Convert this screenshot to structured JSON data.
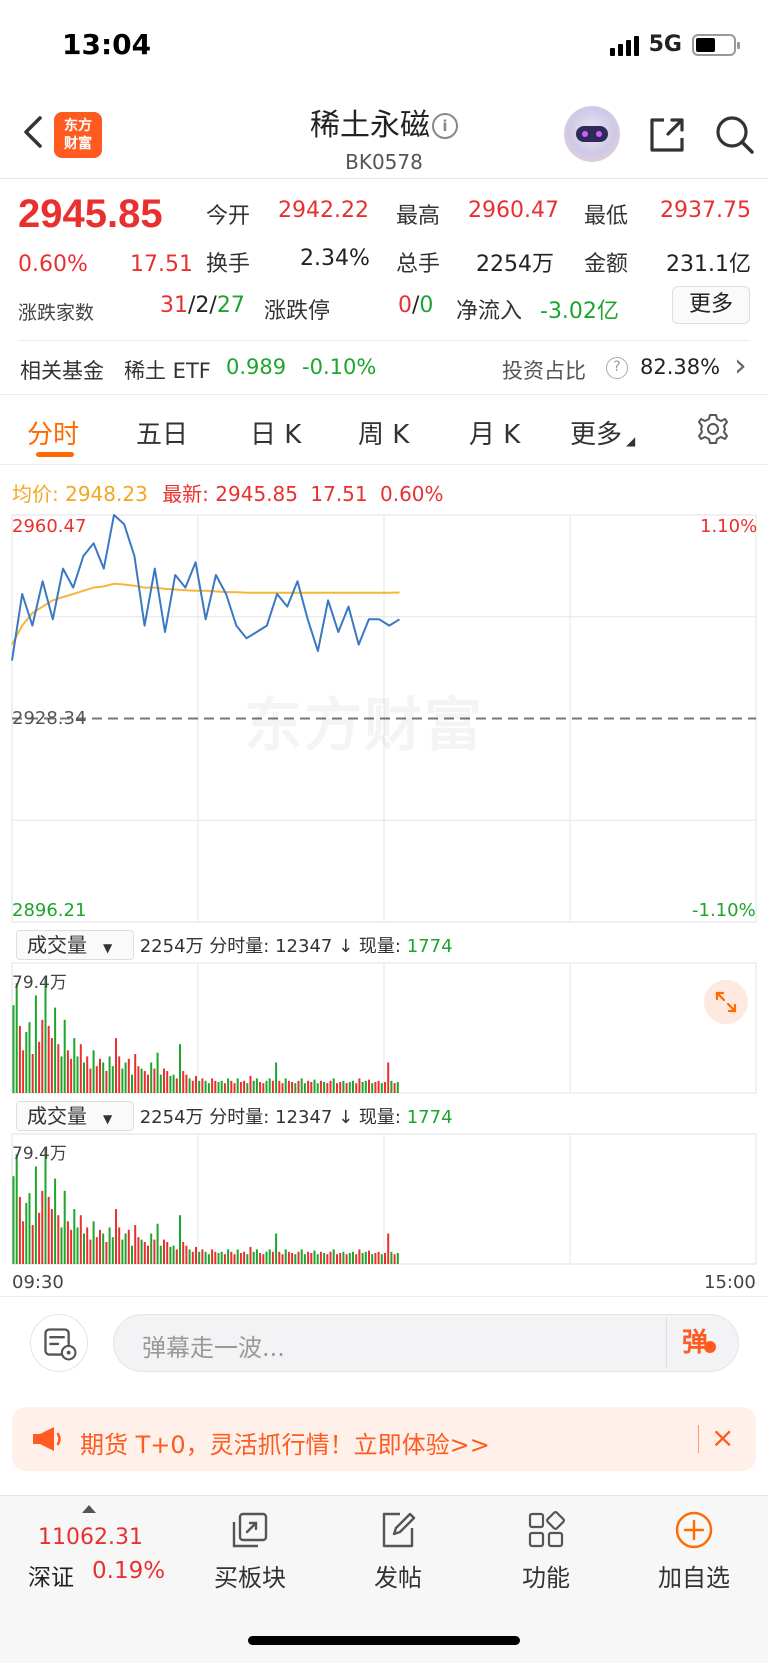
{
  "status_bar": {
    "time": "13:04",
    "network": "5G",
    "battery_level": 0.55
  },
  "header": {
    "logo_text_1": "东方",
    "logo_text_2": "财富",
    "title": "稀土永磁",
    "info_icon_glyph": "i",
    "code": "BK0578"
  },
  "quote": {
    "price": "2945.85",
    "change_pct": "0.60%",
    "change": "17.51",
    "open_label": "今开",
    "open": "2942.22",
    "high_label": "最高",
    "high": "2960.47",
    "low_label": "最低",
    "low": "2937.75",
    "turnover_label": "换手",
    "turnover": "2.34%",
    "total_hands_label": "总手",
    "total_hands": "2254万",
    "amount_label": "金额",
    "amount": "231.1亿",
    "breadth_label": "涨跌家数",
    "breadth_up": "31",
    "breadth_sep1": "/",
    "breadth_flat": "2",
    "breadth_sep2": "/",
    "breadth_down": "27",
    "limit_label": "涨跌停",
    "limit_up": "0",
    "limit_sep": "/",
    "limit_down": "0",
    "net_inflow_label": "净流入",
    "net_inflow": "-3.02亿",
    "more_button": "更多"
  },
  "fund": {
    "label": "相关基金",
    "name": "稀土 ETF",
    "price": "0.989",
    "change": "-0.10%",
    "ratio_label": "投资占比",
    "help_glyph": "?",
    "ratio": "82.38%",
    "chevron": "›"
  },
  "tabs": [
    "分时",
    "五日",
    "日 K",
    "周 K",
    "月 K",
    "更多"
  ],
  "legend": {
    "avg_label": "均价:",
    "avg": "2948.23",
    "latest_label": "最新:",
    "latest": "2945.85",
    "change": "17.51",
    "pct": "0.60%"
  },
  "colors": {
    "accent": "#ff6a00",
    "up": "#e8312f",
    "down": "#1da52d",
    "price_line": "#3a78c4",
    "avg_line": "#f5b73b"
  },
  "chart_data": {
    "type": "line",
    "y_left_max": "2960.47",
    "y_left_mid": "2928.34",
    "y_left_min": "2896.21",
    "y_right_max": "1.10%",
    "y_right_min": "-1.10%",
    "ylim": [
      2896.21,
      2960.47
    ],
    "prev_close": 2928.34,
    "watermark": "东方财富",
    "x_start": "09:30",
    "x_end": "15:00",
    "price_series": [
      2937.5,
      2948,
      2943,
      2950,
      2944,
      2952,
      2949,
      2954,
      2956,
      2952,
      2960.47,
      2959,
      2954,
      2943,
      2952,
      2942,
      2951,
      2949,
      2953,
      2944,
      2951,
      2948,
      2943,
      2941,
      2942,
      2943,
      2948,
      2946,
      2950,
      2944,
      2939,
      2947,
      2942,
      2946,
      2940,
      2944,
      2944,
      2943,
      2944
    ],
    "avg_series": [
      2940,
      2943,
      2945,
      2946,
      2947,
      2947.5,
      2948,
      2948.5,
      2949,
      2949.2,
      2949.6,
      2949.5,
      2949.3,
      2949,
      2949,
      2948.8,
      2948.7,
      2948.6,
      2948.5,
      2948.5,
      2948.4,
      2948.3,
      2948.3,
      2948.2,
      2948.2,
      2948.2,
      2948.2,
      2948.2,
      2948.2,
      2948.2,
      2948.2,
      2948.2,
      2948.2,
      2948.2,
      2948.2,
      2948.2,
      2948.2,
      2948.2,
      2948.23
    ],
    "volume_panels": [
      {
        "selector": "成交量",
        "total": "2254万",
        "minute_label": "分时量:",
        "minute": "12347",
        "arrow": "↓",
        "current_label": "现量:",
        "current": "1774",
        "max_label": "79.4万"
      },
      {
        "selector": "成交量",
        "total": "2254万",
        "minute_label": "分时量:",
        "minute": "12347",
        "arrow": "↓",
        "current_label": "现量:",
        "current": "1774",
        "max_label": "79.4万"
      }
    ],
    "volume_values": [
      0.72,
      0.9,
      0.55,
      0.35,
      0.5,
      0.58,
      0.32,
      0.8,
      0.42,
      0.6,
      0.95,
      0.55,
      0.45,
      0.7,
      0.4,
      0.3,
      0.6,
      0.35,
      0.28,
      0.45,
      0.3,
      0.4,
      0.25,
      0.3,
      0.2,
      0.35,
      0.22,
      0.28,
      0.25,
      0.18,
      0.3,
      0.22,
      0.45,
      0.3,
      0.2,
      0.25,
      0.28,
      0.15,
      0.32,
      0.22,
      0.2,
      0.18,
      0.15,
      0.25,
      0.2,
      0.33,
      0.15,
      0.2,
      0.18,
      0.14,
      0.15,
      0.12,
      0.4,
      0.18,
      0.15,
      0.12,
      0.1,
      0.14,
      0.1,
      0.12,
      0.1,
      0.08,
      0.12,
      0.1,
      0.09,
      0.1,
      0.08,
      0.12,
      0.1,
      0.08,
      0.12,
      0.09,
      0.1,
      0.08,
      0.14,
      0.1,
      0.12,
      0.09,
      0.08,
      0.1,
      0.12,
      0.1,
      0.25,
      0.1,
      0.08,
      0.12,
      0.1,
      0.09,
      0.08,
      0.1,
      0.12,
      0.08,
      0.1,
      0.09,
      0.11,
      0.08,
      0.1,
      0.09,
      0.08,
      0.1,
      0.12,
      0.08,
      0.09,
      0.1,
      0.08,
      0.09,
      0.1,
      0.08,
      0.12,
      0.09,
      0.1,
      0.11,
      0.08,
      0.09,
      0.1,
      0.08,
      0.09,
      0.25,
      0.1,
      0.08,
      0.09
    ]
  },
  "danmu": {
    "placeholder": "弹幕走一波...",
    "send_label": "弹"
  },
  "promo": {
    "text": "期货 T+0，灵活抓行情！立即体验>>",
    "close": "×"
  },
  "bottom_nav": {
    "index_value": "11062.31",
    "index_name": "深证",
    "index_pct": "0.19%",
    "items": [
      "买板块",
      "发帖",
      "功能",
      "加自选"
    ]
  }
}
